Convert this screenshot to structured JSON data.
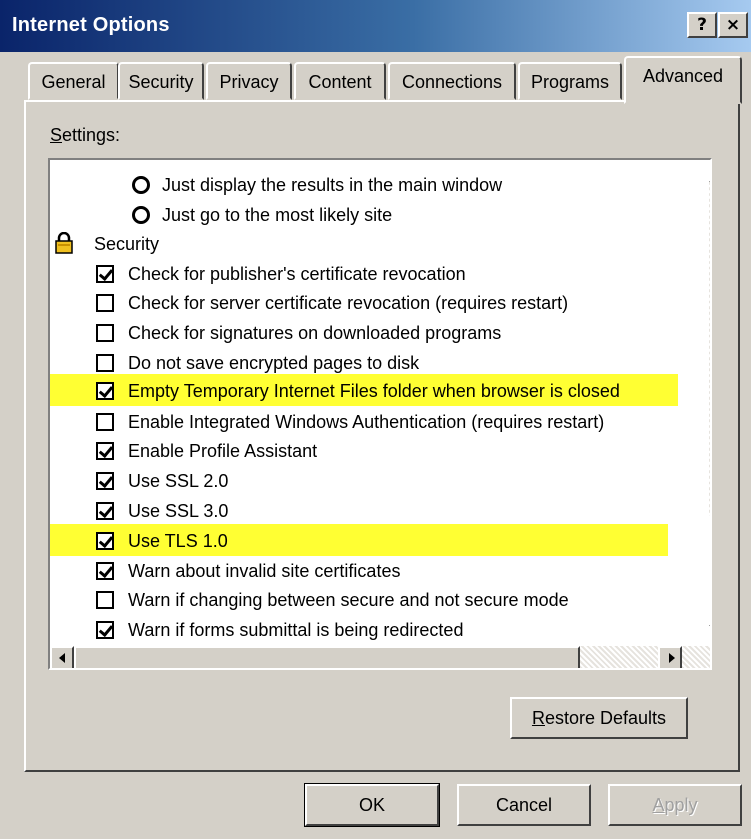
{
  "window": {
    "title": "Internet Options",
    "help_glyph": "?",
    "close_glyph": "×"
  },
  "tabs": [
    {
      "label": "General"
    },
    {
      "label": "Security"
    },
    {
      "label": "Privacy"
    },
    {
      "label": "Content"
    },
    {
      "label": "Connections"
    },
    {
      "label": "Programs"
    },
    {
      "label": "Advanced",
      "active": true
    }
  ],
  "settings": {
    "label_first": "S",
    "label_rest": "ettings:",
    "items": [
      {
        "type": "radio",
        "label": "Just display the results in the main window"
      },
      {
        "type": "radio",
        "label": "Just go to the most likely site"
      },
      {
        "type": "group",
        "label": "Security",
        "icon": "lock-icon"
      },
      {
        "type": "checkbox",
        "label": "Check for publisher's certificate revocation",
        "checked": true
      },
      {
        "type": "checkbox",
        "label": "Check for server certificate revocation (requires restart)",
        "checked": false
      },
      {
        "type": "checkbox",
        "label": "Check for signatures on downloaded programs",
        "checked": false
      },
      {
        "type": "checkbox",
        "label": "Do not save encrypted pages to disk",
        "checked": false
      },
      {
        "type": "checkbox",
        "label": "Empty Temporary Internet Files folder when browser is closed",
        "checked": true,
        "highlight": true
      },
      {
        "type": "checkbox",
        "label": "Enable Integrated Windows Authentication (requires restart)",
        "checked": false
      },
      {
        "type": "checkbox",
        "label": "Enable Profile Assistant",
        "checked": true
      },
      {
        "type": "checkbox",
        "label": "Use SSL 2.0",
        "checked": true
      },
      {
        "type": "checkbox",
        "label": "Use SSL 3.0",
        "checked": true
      },
      {
        "type": "checkbox",
        "label": "Use TLS 1.0",
        "checked": true,
        "highlight": true
      },
      {
        "type": "checkbox",
        "label": "Warn about invalid site certificates",
        "checked": true
      },
      {
        "type": "checkbox",
        "label": "Warn if changing between secure and not secure mode",
        "checked": false
      },
      {
        "type": "checkbox",
        "label": "Warn if forms submittal is being redirected",
        "checked": true
      }
    ]
  },
  "buttons": {
    "restore_first": "R",
    "restore_rest": "estore Defaults",
    "ok": "OK",
    "cancel": "Cancel",
    "apply_first": "A",
    "apply_rest": "pply"
  },
  "colors": {
    "highlight": "#ffff33",
    "titlebar_start": "#0a246a",
    "face": "#d4d0c8"
  }
}
